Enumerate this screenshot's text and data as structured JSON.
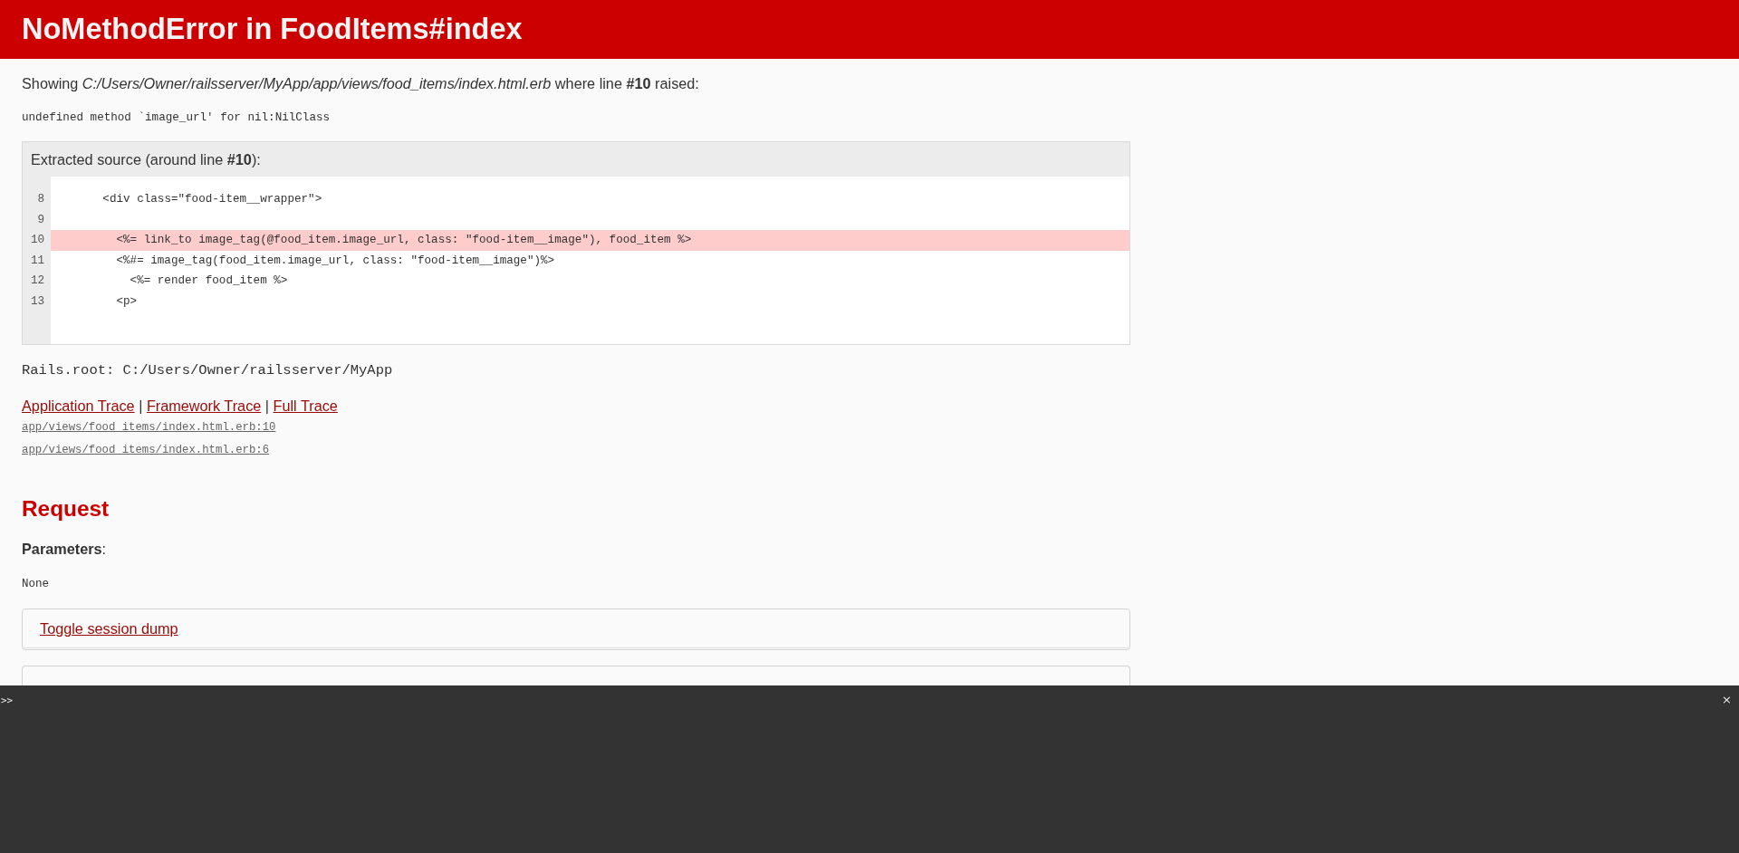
{
  "header": {
    "title": "NoMethodError in FoodItems#index"
  },
  "summary": "Showing *C:/Users/Owner/railsserver/MyApp/app/views/food_items/index.html.erb* where line **#10** raised:",
  "message": "undefined method `image_url' for nil:NilClass",
  "source": {
    "title": "Extracted source (around line **#10**):",
    "lines": [
      {
        "number": "8",
        "code": "      <div class=\"food-item__wrapper\">",
        "highlighted": false
      },
      {
        "number": "9",
        "highlighted": false
      },
      {
        "number": "10",
        "code": "        <%= link_to image_tag(@food_item.image_url, class: \"food-item__image\"), food_item %>",
        "highlighted": true
      },
      {
        "number": "11",
        "code": "        <%#= image_tag(food_item.image_url, class: \"food-item__image\")%>",
        "highlighted": false
      },
      {
        "number": "12",
        "code": "          <%= render food_item %>",
        "highlighted": false
      },
      {
        "number": "13",
        "code": "        <p>",
        "highlighted": false
      }
    ]
  },
  "rails_root": "Rails.root: C:/Users/Owner/railsserver/MyApp",
  "trace": {
    "links": [
      {
        "kind": "link",
        "label": "Application Trace"
      },
      {
        "kind": "separator",
        "label": "|"
      },
      {
        "kind": "link",
        "label": "Framework Trace"
      },
      {
        "kind": "separator",
        "label": "|"
      },
      {
        "kind": "link",
        "label": "Full Trace"
      }
    ],
    "lines": [
      "app/views/food_items/index.html.erb:10",
      "app/views/food_items/index.html.erb:6"
    ]
  },
  "request": {
    "title": "Request",
    "parameters_label": "**Parameters**:",
    "parameters_value": "None",
    "toggles": [
      "Toggle session dump"
    ],
    "covered_panel": true
  },
  "console": {
    "prompt": ">>",
    "close": "×"
  }
}
